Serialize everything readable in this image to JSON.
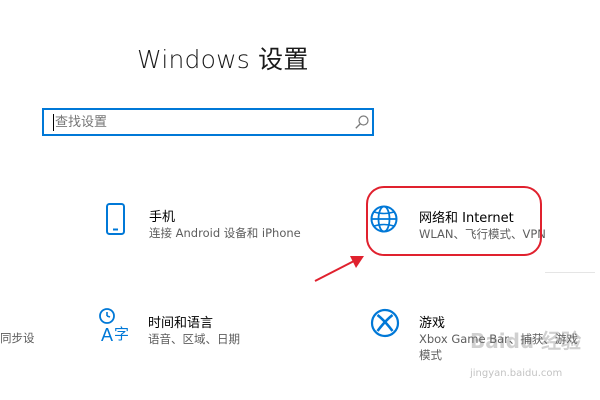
{
  "header": {
    "title": "Windows 设置"
  },
  "search": {
    "placeholder": "查找设置",
    "value": ""
  },
  "tiles": [
    {
      "title": "手机",
      "subtitle": "连接 Android 设备和 iPhone",
      "icon": "phone-icon"
    },
    {
      "title": "网络和 Internet",
      "subtitle": "WLAN、飞行模式、VPN",
      "icon": "globe-icon"
    },
    {
      "title": "",
      "subtitle": "同步设",
      "icon": ""
    },
    {
      "title": "时间和语言",
      "subtitle": "语音、区域、日期",
      "icon": "time-language-icon"
    },
    {
      "title": "游戏",
      "subtitle": "Xbox Game Bar、捕获、游戏",
      "subtitle2": "模式",
      "icon": "xbox-icon"
    }
  ],
  "annotation": {
    "highlight_color": "#e0212e",
    "arrow_color": "#e0212e"
  },
  "watermark": {
    "text": "Baidu 经验",
    "sub": "jingyan.baidu.com"
  },
  "colors": {
    "accent": "#0078d7",
    "text": "#000000",
    "secondary_text": "#5d5d5d"
  }
}
